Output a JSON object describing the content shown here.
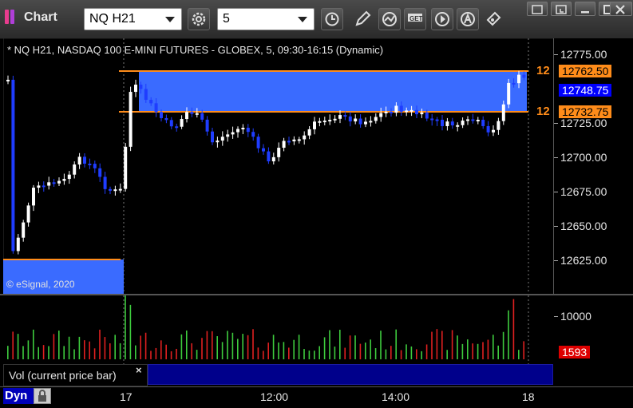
{
  "app": {
    "title": "Chart"
  },
  "toolbar": {
    "symbol_value": "NQ H21",
    "interval_value": "5",
    "icons": [
      "settings-gear-icon",
      "clock-icon",
      "pencil-draw-icon",
      "study-icon",
      "get-icon",
      "play-icon",
      "account-icon",
      "arrow-tool-icon"
    ]
  },
  "chart": {
    "symbol_line": "* NQ H21, NASDAQ 100 E-MINI FUTURES - GLOBEX, 5, 09:30-16:15 (Dynamic)",
    "copyright": "© eSignal, 2020",
    "y_ticks": [
      "12775.00",
      "12750.00",
      "12725.00",
      "12700.00",
      "12675.00",
      "12650.00",
      "12625.00"
    ],
    "price_upper": "12762.50",
    "price_last": "12748.75",
    "price_lower": "12732.75",
    "tag_upper": "12",
    "tag_lower": "12",
    "colors": {
      "up": "#ffffff",
      "down": "#1f3dff",
      "zone": "#3a6bff",
      "level": "#ff8c1a"
    }
  },
  "volume": {
    "label": "Vol (current price bar)",
    "close_glyph": "×",
    "y_tick": "10000",
    "last_value": "1593"
  },
  "x_axis": {
    "ticks": [
      "17",
      "12:00",
      "14:00",
      "18"
    ]
  },
  "footer": {
    "dyn_label": "Dyn"
  }
}
